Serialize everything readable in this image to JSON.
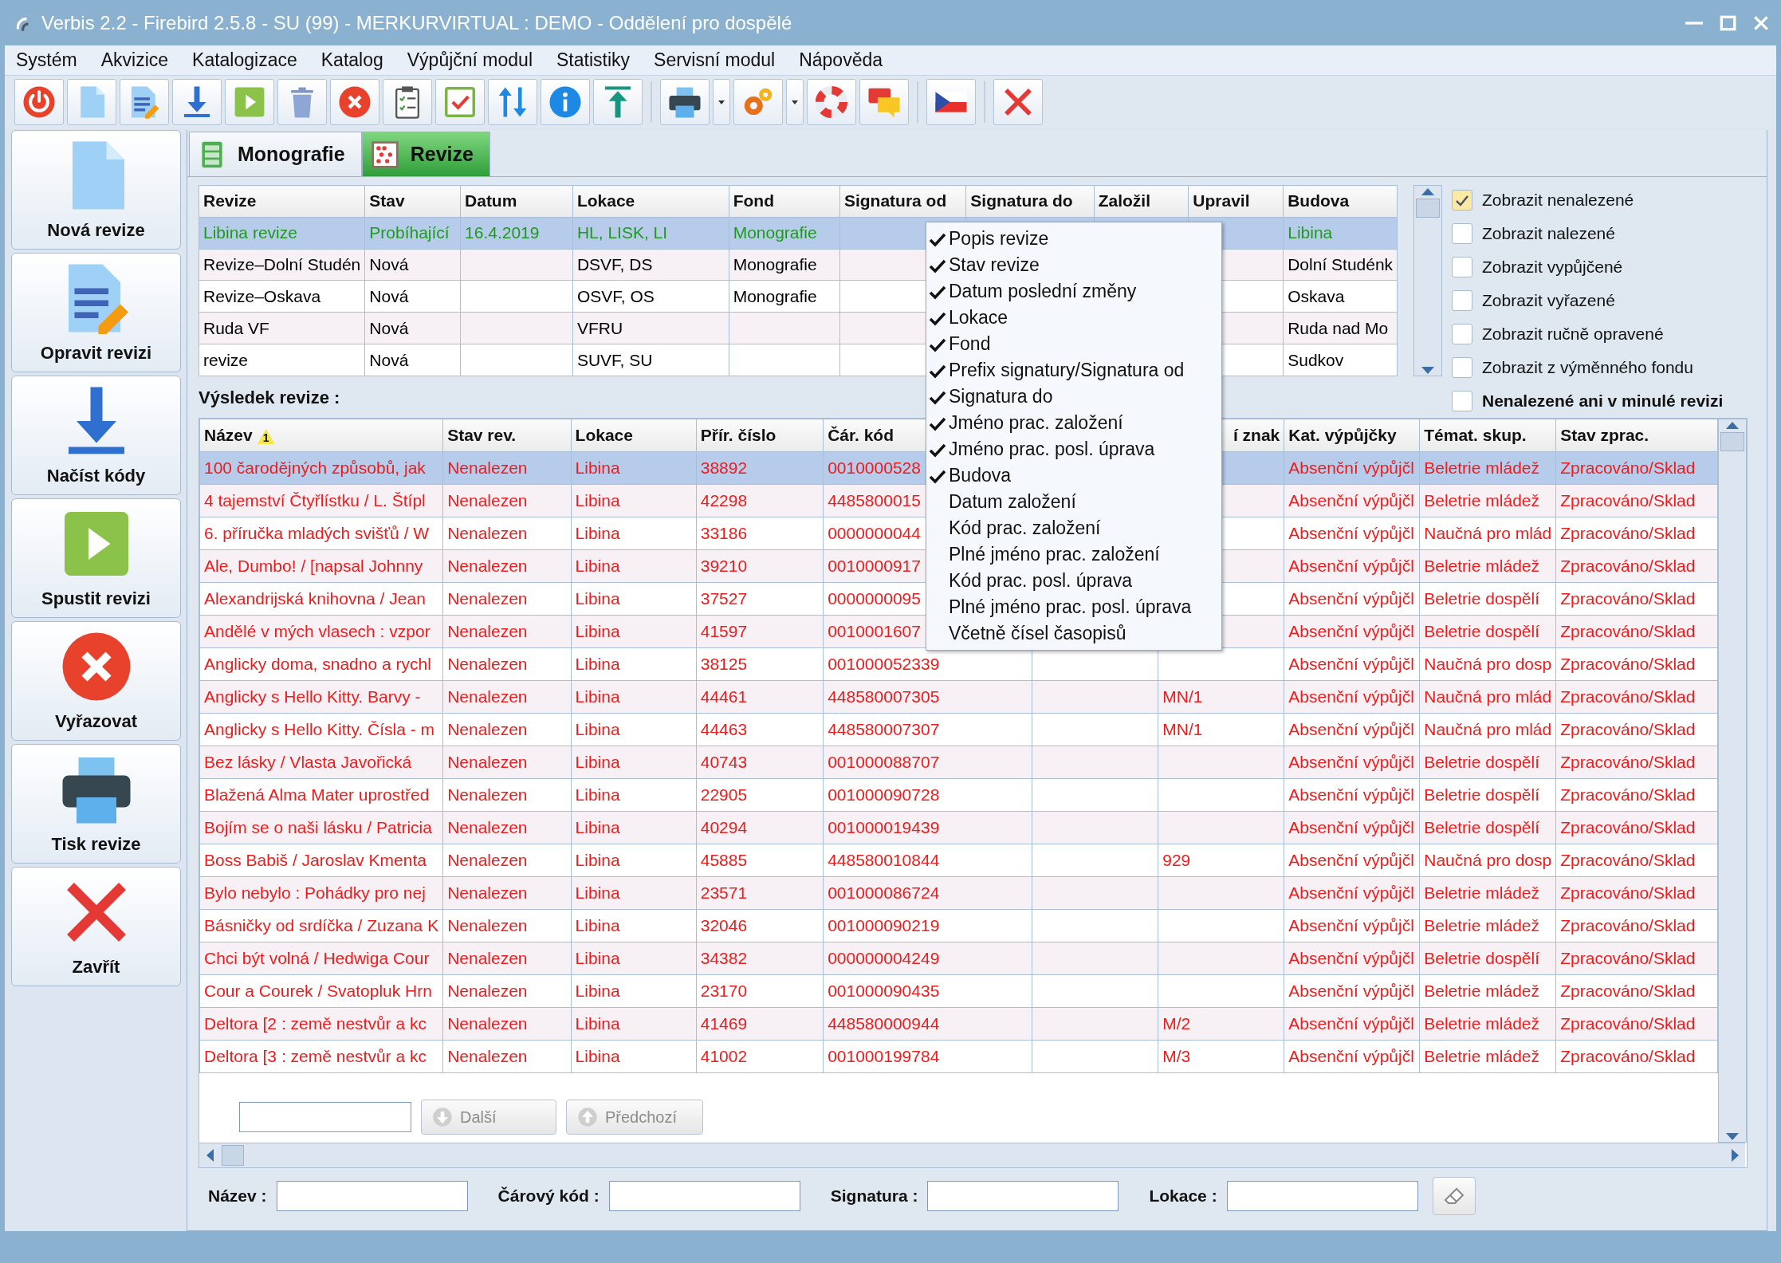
{
  "window": {
    "title": "Verbis 2.2 - Firebird 2.5.8 - SU (99) - MERKURVIRTUAL : DEMO - Oddělení pro dospělé"
  },
  "menu": [
    "Systém",
    "Akvizice",
    "Katalogizace",
    "Katalog",
    "Výpůjční modul",
    "Statistiky",
    "Servisní modul",
    "Nápověda"
  ],
  "sidebar": [
    {
      "label": "Nová revize"
    },
    {
      "label": "Opravit revizi"
    },
    {
      "label": "Načíst kódy"
    },
    {
      "label": "Spustit revizi"
    },
    {
      "label": "Vyřazovat"
    },
    {
      "label": "Tisk revize"
    },
    {
      "label": "Zavřít"
    }
  ],
  "tabs": [
    {
      "label": "Monografie",
      "selected": false
    },
    {
      "label": "Revize",
      "selected": true
    }
  ],
  "revisions": {
    "columns": [
      "Revize",
      "Stav",
      "Datum",
      "Lokace",
      "Fond",
      "Signatura od",
      "Signatura do",
      "Založil",
      "Upravil",
      "Budova"
    ],
    "rows": [
      {
        "name": "Libina revize",
        "status": "Probíhající",
        "date": "16.4.2019",
        "location": "HL, LISK, LI",
        "fund": "Monografie",
        "building": "Libina",
        "selected": true,
        "active": true
      },
      {
        "name": "Revize–Dolní Studén",
        "status": "Nová",
        "location": "DSVF, DS",
        "fund": "Monografie",
        "building": "Dolní Studénk",
        "selected": false,
        "active": false
      },
      {
        "name": "Revize–Oskava",
        "status": "Nová",
        "location": "OSVF, OS",
        "fund": "Monografie",
        "building": "Oskava",
        "selected": false,
        "active": false
      },
      {
        "name": "Ruda VF",
        "status": "Nová",
        "location": "VFRU",
        "building": "Ruda nad Mo",
        "selected": false,
        "active": false
      },
      {
        "name": "revize",
        "status": "Nová",
        "location": "SUVF, SU",
        "building": "Sudkov",
        "selected": false,
        "active": false
      }
    ]
  },
  "filters": [
    {
      "label": "Zobrazit nenalezené",
      "checked": true
    },
    {
      "label": "Zobrazit nalezené",
      "checked": false
    },
    {
      "label": "Zobrazit vypůjčené",
      "checked": false
    },
    {
      "label": "Zobrazit vyřazené",
      "checked": false
    },
    {
      "label": "Zobrazit ručně opravené",
      "checked": false
    },
    {
      "label": "Zobrazit z výměnného fondu",
      "checked": false
    },
    {
      "label": "Nenalezené ani v minulé revizi",
      "checked": false
    }
  ],
  "result": {
    "heading": "Výsledek revize :",
    "columns": [
      {
        "label": "Název",
        "sort_order": "1"
      },
      {
        "label": "Stav rev."
      },
      {
        "label": "Lokace"
      },
      {
        "label": "Přír. číslo"
      },
      {
        "label": "Čár. kód"
      },
      {
        "label": "í znak"
      },
      {
        "label": "Kat. výpůjčky"
      },
      {
        "label": "Témat. skup."
      },
      {
        "label": "Stav zprac."
      }
    ],
    "rows": [
      {
        "title": "100 čarodějných způsobů, jak",
        "status": "Nenalezen",
        "location": "Libina",
        "accession": "38892",
        "barcode": "0010000528",
        "loan_category": "Absenční výpůjčl",
        "subject_group": "Beletrie mládež",
        "processing": "Zpracováno/Sklad",
        "selected": true,
        "found": false
      },
      {
        "title": "4 tajemství Čtyřlístku / L. Štípl",
        "status": "Nenalezen",
        "location": "Libina",
        "accession": "42298",
        "barcode": "4485800015",
        "loan_category": "Absenční výpůjčl",
        "subject_group": "Beletrie mládež",
        "processing": "Zpracováno/Sklad",
        "selected": false,
        "found": false
      },
      {
        "title": "6. příručka mladých svišťů / W",
        "status": "Nenalezen",
        "location": "Libina",
        "accession": "33186",
        "barcode": "0000000044",
        "loan_category": "Absenční výpůjčl",
        "subject_group": "Naučná pro mlád",
        "processing": "Zpracováno/Sklad",
        "selected": false,
        "found": false
      },
      {
        "title": "Ale, Dumbo! / [napsal Johnny",
        "status": "Nenalezen",
        "location": "Libina",
        "accession": "39210",
        "barcode": "0010000917",
        "loan_category": "Absenční výpůjčl",
        "subject_group": "Beletrie mládež",
        "processing": "Zpracováno/Sklad",
        "selected": false,
        "found": false
      },
      {
        "title": "Alexandrijská knihovna / Jean",
        "status": "Nenalezen",
        "location": "Libina",
        "accession": "37527",
        "barcode": "0000000095",
        "loan_category": "Absenční výpůjčl",
        "subject_group": "Beletrie dospělí",
        "processing": "Zpracováno/Sklad",
        "selected": false,
        "found": false
      },
      {
        "title": "Andělé v mých vlasech : vzpor",
        "status": "Nenalezen",
        "location": "Libina",
        "accession": "41597",
        "barcode": "0010001607",
        "loan_category": "Absenční výpůjčl",
        "subject_group": "Beletrie dospělí",
        "processing": "Zpracováno/Sklad",
        "selected": false,
        "found": false
      },
      {
        "title": "Anglicky doma, snadno a rychl",
        "status": "Nenalezen",
        "location": "Libina",
        "accession": "38125",
        "barcode": "001000052339",
        "loan_category": "Absenční výpůjčl",
        "subject_group": "Naučná pro dosp",
        "processing": "Zpracováno/Sklad",
        "selected": false,
        "found": false
      },
      {
        "title": "Anglicky s Hello Kitty. Barvy -",
        "status": "Nenalezen",
        "location": "Libina",
        "accession": "44461",
        "barcode": "448580007305",
        "column_6": "MN/1",
        "loan_category": "Absenční výpůjčl",
        "subject_group": "Naučná pro mlád",
        "processing": "Zpracováno/Sklad",
        "selected": false,
        "found": false
      },
      {
        "title": "Anglicky s Hello Kitty. Čísla - m",
        "status": "Nenalezen",
        "location": "Libina",
        "accession": "44463",
        "barcode": "448580007307",
        "column_6": "MN/1",
        "loan_category": "Absenční výpůjčl",
        "subject_group": "Naučná pro mlád",
        "processing": "Zpracováno/Sklad",
        "selected": false,
        "found": false
      },
      {
        "title": "Bez lásky / Vlasta Javořická",
        "status": "Nenalezen",
        "location": "Libina",
        "accession": "40743",
        "barcode": "001000088707",
        "loan_category": "Absenční výpůjčl",
        "subject_group": "Beletrie dospělí",
        "processing": "Zpracováno/Sklad",
        "selected": false,
        "found": false
      },
      {
        "title": "Blažená Alma Mater uprostřed",
        "status": "Nenalezen",
        "location": "Libina",
        "accession": "22905",
        "barcode": "001000090728",
        "loan_category": "Absenční výpůjčl",
        "subject_group": "Beletrie dospělí",
        "processing": "Zpracováno/Sklad",
        "selected": false,
        "found": false
      },
      {
        "title": "Bojím se o naši lásku / Patricia",
        "status": "Nenalezen",
        "location": "Libina",
        "accession": "40294",
        "barcode": "001000019439",
        "loan_category": "Absenční výpůjčl",
        "subject_group": "Beletrie dospělí",
        "processing": "Zpracováno/Sklad",
        "selected": false,
        "found": false
      },
      {
        "title": "Boss Babiš / Jaroslav Kmenta",
        "status": "Nenalezen",
        "location": "Libina",
        "accession": "45885",
        "barcode": "448580010844",
        "column_6": "929",
        "loan_category": "Absenční výpůjčl",
        "subject_group": "Naučná pro dosp",
        "processing": "Zpracováno/Sklad",
        "selected": false,
        "found": false
      },
      {
        "title": "Bylo nebylo : Pohádky pro nej",
        "status": "Nenalezen",
        "location": "Libina",
        "accession": "23571",
        "barcode": "001000086724",
        "loan_category": "Absenční výpůjčl",
        "subject_group": "Beletrie mládež",
        "processing": "Zpracováno/Sklad",
        "selected": false,
        "found": false
      },
      {
        "title": "Básničky od srdíčka / Zuzana K",
        "status": "Nenalezen",
        "location": "Libina",
        "accession": "32046",
        "barcode": "001000090219",
        "loan_category": "Absenční výpůjčl",
        "subject_group": "Beletrie mládež",
        "processing": "Zpracováno/Sklad",
        "selected": false,
        "found": false
      },
      {
        "title": "Chci být volná / Hedwiga Cour",
        "status": "Nenalezen",
        "location": "Libina",
        "accession": "34382",
        "barcode": "000000004249",
        "loan_category": "Absenční výpůjčl",
        "subject_group": "Beletrie dospělí",
        "processing": "Zpracováno/Sklad",
        "selected": false,
        "found": false
      },
      {
        "title": "Cour a Courek / Svatopluk Hrn",
        "status": "Nenalezen",
        "location": "Libina",
        "accession": "23170",
        "barcode": "001000090435",
        "loan_category": "Absenční výpůjčl",
        "subject_group": "Beletrie mládež",
        "processing": "Zpracováno/Sklad",
        "selected": false,
        "found": false
      },
      {
        "title": "Deltora [2 : země nestvůr a kc",
        "status": "Nenalezen",
        "location": "Libina",
        "accession": "41469",
        "barcode": "448580000944",
        "column_6": "M/2",
        "loan_category": "Absenční výpůjčl",
        "subject_group": "Beletrie mládež",
        "processing": "Zpracováno/Sklad",
        "selected": false,
        "found": false
      },
      {
        "title": "Deltora [3 : země nestvůr a kc",
        "status": "Nenalezen",
        "location": "Libina",
        "accession": "41002",
        "barcode": "001000199784",
        "column_6": "M/3",
        "loan_category": "Absenční výpůjčl",
        "subject_group": "Beletrie mládež",
        "processing": "Zpracováno/Sklad",
        "selected": false,
        "found": false
      }
    ]
  },
  "search": {
    "buttons": [
      {
        "label": "Další",
        "disabled": true
      },
      {
        "label": "Předchozí",
        "disabled": true
      }
    ]
  },
  "filter_bar": [
    {
      "label": "Název :"
    },
    {
      "label": "Čárový kód :"
    },
    {
      "label": "Signatura :"
    },
    {
      "label": "Lokace :"
    }
  ],
  "column_menu": [
    {
      "label": "Popis revize",
      "checked": true
    },
    {
      "label": "Stav revize",
      "checked": true
    },
    {
      "label": "Datum poslední změny",
      "checked": true
    },
    {
      "label": "Lokace",
      "checked": true
    },
    {
      "label": "Fond",
      "checked": true
    },
    {
      "label": "Prefix signatury/Signatura od",
      "checked": true
    },
    {
      "label": "Signatura do",
      "checked": true
    },
    {
      "label": "Jméno prac. založení",
      "checked": true
    },
    {
      "label": "Jméno prac. posl. úprava",
      "checked": true
    },
    {
      "label": "Budova",
      "checked": true
    },
    {
      "label": "Datum založení",
      "checked": false
    },
    {
      "label": "Kód prac. založení",
      "checked": false
    },
    {
      "label": "Plné jméno prac. založení",
      "checked": false
    },
    {
      "label": "Kód prac. posl. úprava",
      "checked": false
    },
    {
      "label": "Plné jméno prac. posl. úprava",
      "checked": false
    },
    {
      "label": "Včetně čísel časopisů",
      "checked": false
    }
  ]
}
